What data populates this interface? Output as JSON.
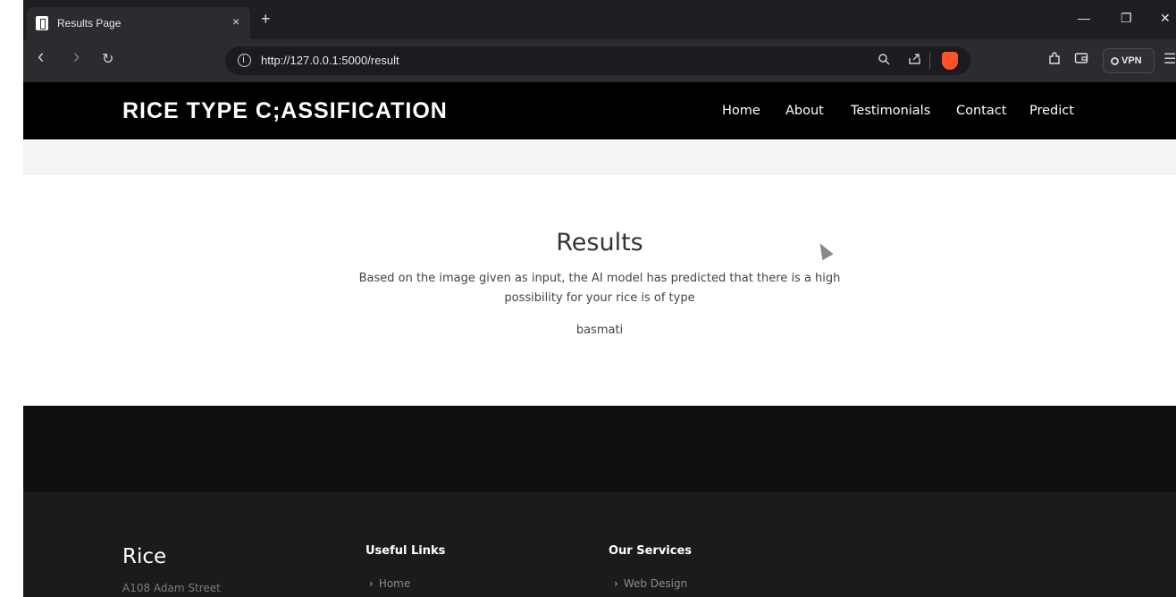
{
  "browser": {
    "tab_title": "Results Page",
    "tab_close": "×",
    "new_tab": "+",
    "url": "http://127.0.0.1:5000/result",
    "vpn_label": "VPN",
    "window_controls": {
      "minimize": "—",
      "restore": "❐",
      "close": "✕"
    },
    "nav": {
      "back": "‹",
      "forward": "›",
      "reload": "↻"
    },
    "icons": [
      "zoom-icon",
      "share-icon",
      "brave-shield-icon",
      "extensions-icon",
      "wallet-icon",
      "menu-icon"
    ]
  },
  "site": {
    "logo": "RICE TYPE C;ASSIFICATION",
    "nav": [
      "Home",
      "About",
      "Testimonials",
      "Contact",
      "Predict"
    ]
  },
  "results": {
    "title": "Results",
    "description": "Based on the image given as input, the AI model has predicted that there is a high possibility for your rice is of type",
    "value": "basmati"
  },
  "footer": {
    "brand": "Rice",
    "address": "A108 Adam Street",
    "useful_links": {
      "heading": "Useful Links",
      "items": [
        "Home"
      ]
    },
    "services": {
      "heading": "Our Services",
      "items": [
        "Web Design"
      ]
    }
  }
}
